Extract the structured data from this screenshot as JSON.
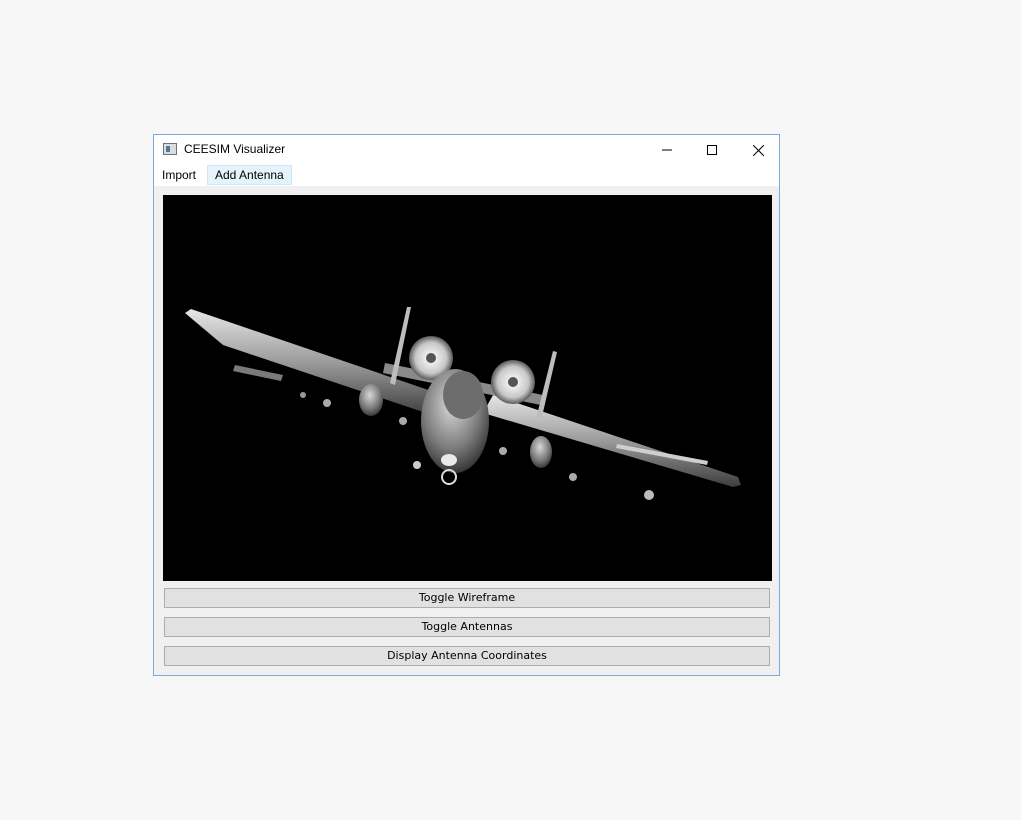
{
  "window": {
    "title": "CEESIM Visualizer",
    "icon": "app-icon"
  },
  "menubar": {
    "items": [
      {
        "label": "Import"
      },
      {
        "label": "Add Antenna"
      }
    ]
  },
  "viewport": {
    "background": "#000000",
    "model": "a-10-aircraft-render"
  },
  "buttons": {
    "toggle_wireframe": "Toggle Wireframe",
    "toggle_antennas": "Toggle Antennas",
    "display_coords": "Display Antenna Coordinates"
  }
}
